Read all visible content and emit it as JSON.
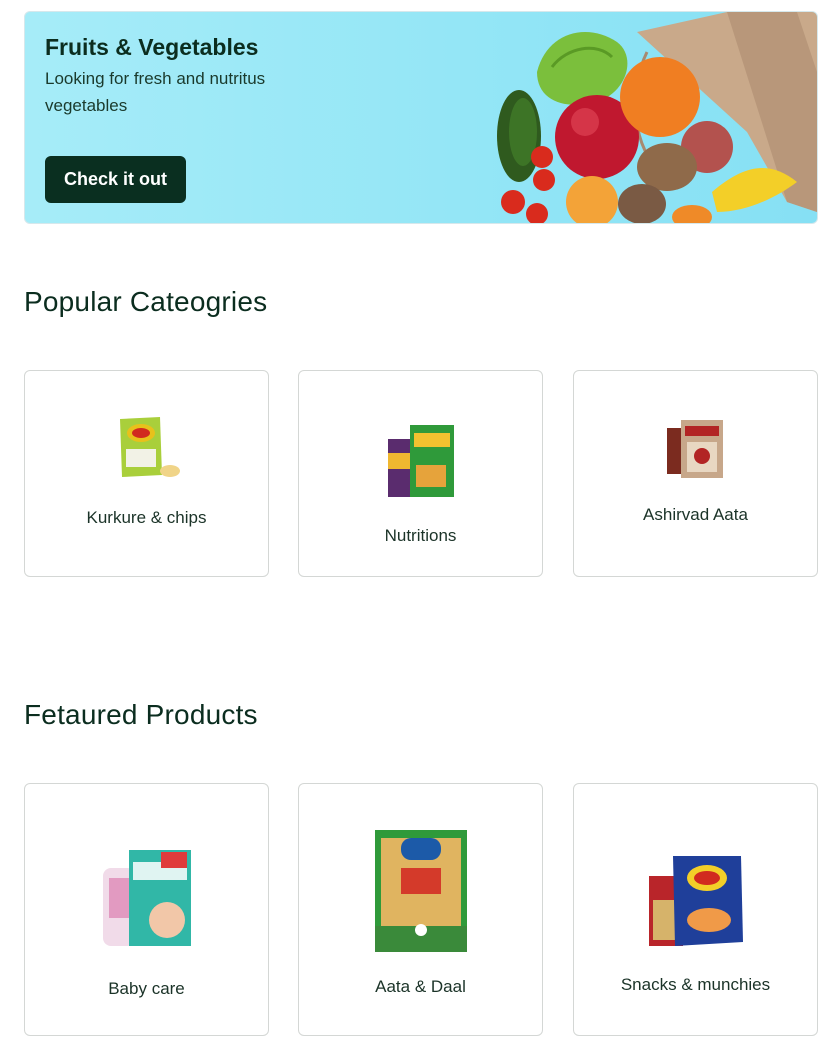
{
  "banner": {
    "title": "Fruits & Vegetables",
    "subtitle": "Looking for fresh and nutritus vegetables",
    "button_label": "Check it out"
  },
  "popular": {
    "title": "Popular Cateogries",
    "items": [
      {
        "label": "Kurkure & chips",
        "icon": "chips-packet-icon"
      },
      {
        "label": "Nutritions",
        "icon": "nutrition-packs-icon"
      },
      {
        "label": "Ashirvad Aata",
        "icon": "aata-bag-icon"
      }
    ]
  },
  "featured": {
    "title": "Fetaured Products",
    "items": [
      {
        "label": "Baby care",
        "icon": "diapers-pack-icon"
      },
      {
        "label": "Aata & Daal",
        "icon": "daal-pack-icon"
      },
      {
        "label": "Snacks & munchies",
        "icon": "snacks-packs-icon"
      }
    ]
  },
  "colors": {
    "banner_bg": "#94e6f6",
    "accent_dark": "#0a2f20",
    "text": "#0b2d1f"
  }
}
